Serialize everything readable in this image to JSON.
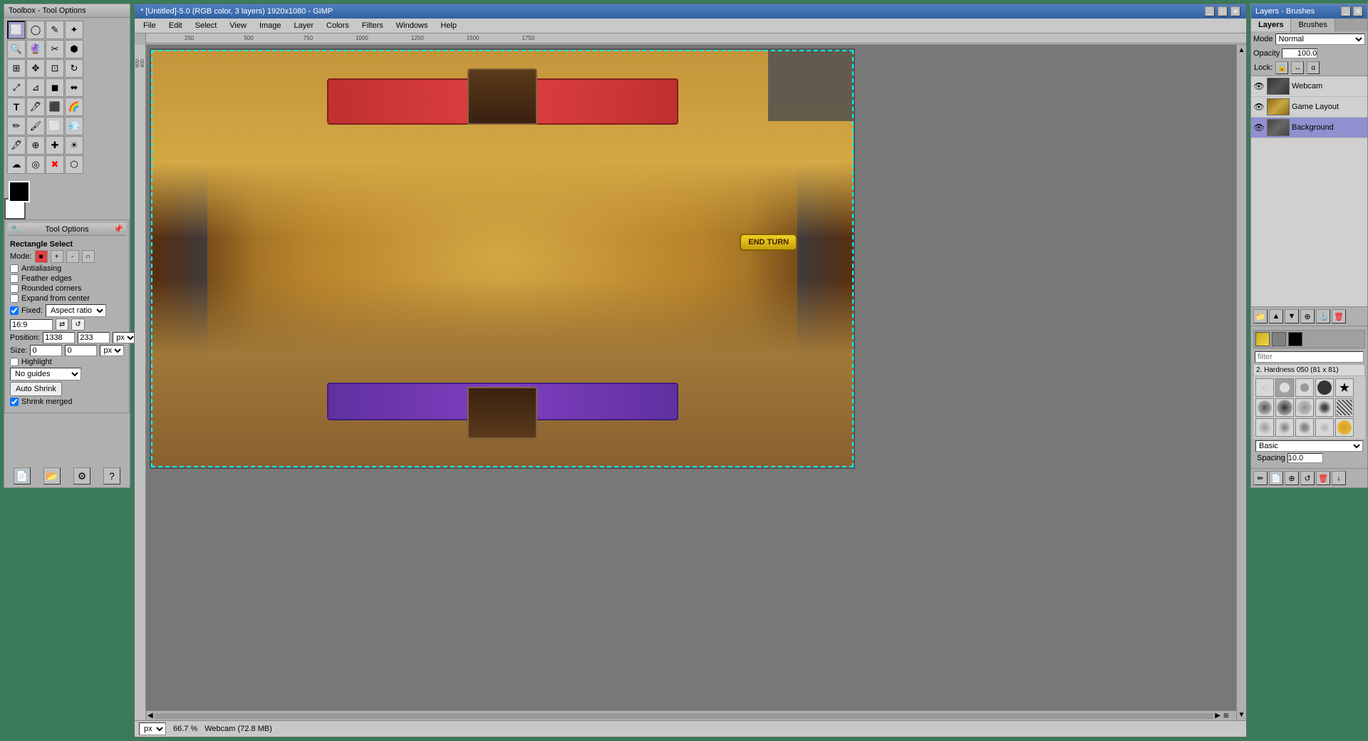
{
  "toolbox": {
    "title": "Toolbox - Tool Options",
    "tools": [
      {
        "name": "rectangle-select",
        "icon": "⬜"
      },
      {
        "name": "ellipse-select",
        "icon": "⭕"
      },
      {
        "name": "free-select",
        "icon": "✏️"
      },
      {
        "name": "fuzzy-select",
        "icon": "🔮"
      },
      {
        "name": "scissors-select",
        "icon": "✂️"
      },
      {
        "name": "foreground-select",
        "icon": "🎯"
      },
      {
        "name": "paths-tool",
        "icon": "🖊"
      },
      {
        "name": "color-picker",
        "icon": "💉"
      },
      {
        "name": "zoom-tool",
        "icon": "🔍"
      },
      {
        "name": "measure-tool",
        "icon": "📏"
      },
      {
        "name": "move-tool",
        "icon": "✥"
      },
      {
        "name": "alignment-tool",
        "icon": "⊞"
      },
      {
        "name": "transform-tool",
        "icon": "↔"
      },
      {
        "name": "cage-transform",
        "icon": "⬡"
      },
      {
        "name": "text-tool",
        "icon": "T"
      },
      {
        "name": "heal-tool",
        "icon": "🩹"
      },
      {
        "name": "perspective-clone",
        "icon": "📐"
      },
      {
        "name": "erase-tool",
        "icon": "⬛"
      },
      {
        "name": "clone-tool",
        "icon": "🔵"
      },
      {
        "name": "smudge-tool",
        "icon": "👆"
      },
      {
        "name": "pencil-tool",
        "icon": "✏"
      },
      {
        "name": "paintbrush",
        "icon": "🖌"
      },
      {
        "name": "airbrush",
        "icon": "💨"
      },
      {
        "name": "ink-tool",
        "icon": "🖋"
      },
      {
        "name": "dodge-burn",
        "icon": "☀"
      },
      {
        "name": "blend-tool",
        "icon": "🌈"
      },
      {
        "name": "bucket-fill",
        "icon": "🪣"
      },
      {
        "name": "convolve",
        "icon": "〰"
      },
      {
        "name": "desaturate",
        "icon": "⊡"
      },
      {
        "name": "script-fu",
        "icon": "⚡"
      },
      {
        "name": "color-balance",
        "icon": "✖"
      },
      {
        "name": "curves",
        "icon": "〰"
      }
    ],
    "foreground_color": "#000000",
    "background_color": "#ffffff"
  },
  "tool_options": {
    "title": "Tool Options",
    "section": "Rectangle Select",
    "mode_label": "Mode:",
    "antialiasing_label": "Antialiasing",
    "antialiasing_checked": false,
    "feather_edges_label": "Feather edges",
    "feather_edges_checked": false,
    "rounded_corners_label": "Rounded corners",
    "rounded_corners_checked": false,
    "expand_from_center_label": "Expand from center",
    "expand_from_center_checked": false,
    "fixed_label": "Fixed:",
    "fixed_checked": true,
    "fixed_option": "Aspect ratio",
    "fixed_value": "16:9",
    "position_label": "Position:",
    "position_x": "1338",
    "position_y": "233",
    "position_unit": "px",
    "size_label": "Size:",
    "size_x": "0",
    "size_y": "0",
    "size_unit": "px",
    "highlight_label": "Highlight",
    "highlight_checked": false,
    "guides_label": "No guides",
    "auto_shrink_label": "Auto Shrink",
    "shrink_merged_label": "Shrink merged",
    "shrink_merged_checked": true
  },
  "gimp_window": {
    "title": "* [Untitled]-5.0 (RGB color, 3 layers) 1920x1080 - GIMP",
    "menu_items": [
      "File",
      "Edit",
      "Select",
      "View",
      "Image",
      "Layer",
      "Colors",
      "Filters",
      "Windows",
      "Help"
    ],
    "canvas_info": "Webcam (72.8 MB)",
    "zoom_level": "66.7 %",
    "unit": "px",
    "ruler_marks": [
      "250",
      "500",
      "750",
      "1000",
      "1250",
      "1500",
      "1750"
    ],
    "end_turn_text": "END TURN"
  },
  "layers_panel": {
    "title": "Layers - Brushes",
    "tabs": [
      {
        "name": "layers-tab",
        "label": "Layers"
      },
      {
        "name": "brushes-tab",
        "label": "Brushes"
      }
    ],
    "mode": "Normal",
    "opacity": "100.0",
    "lock_label": "Lock:",
    "layers": [
      {
        "name": "Webcam",
        "visible": true,
        "type": "webcam",
        "selected": false
      },
      {
        "name": "Game Layout",
        "visible": true,
        "type": "gamelayout",
        "selected": false
      },
      {
        "name": "Background",
        "visible": true,
        "type": "background",
        "selected": true
      }
    ],
    "filter_placeholder": "filter",
    "brush_categories": [
      "2. Hardness 050 (81 x 81)"
    ],
    "basic_label": "Basic",
    "spacing_label": "Spacing",
    "spacing_value": "10.0"
  }
}
